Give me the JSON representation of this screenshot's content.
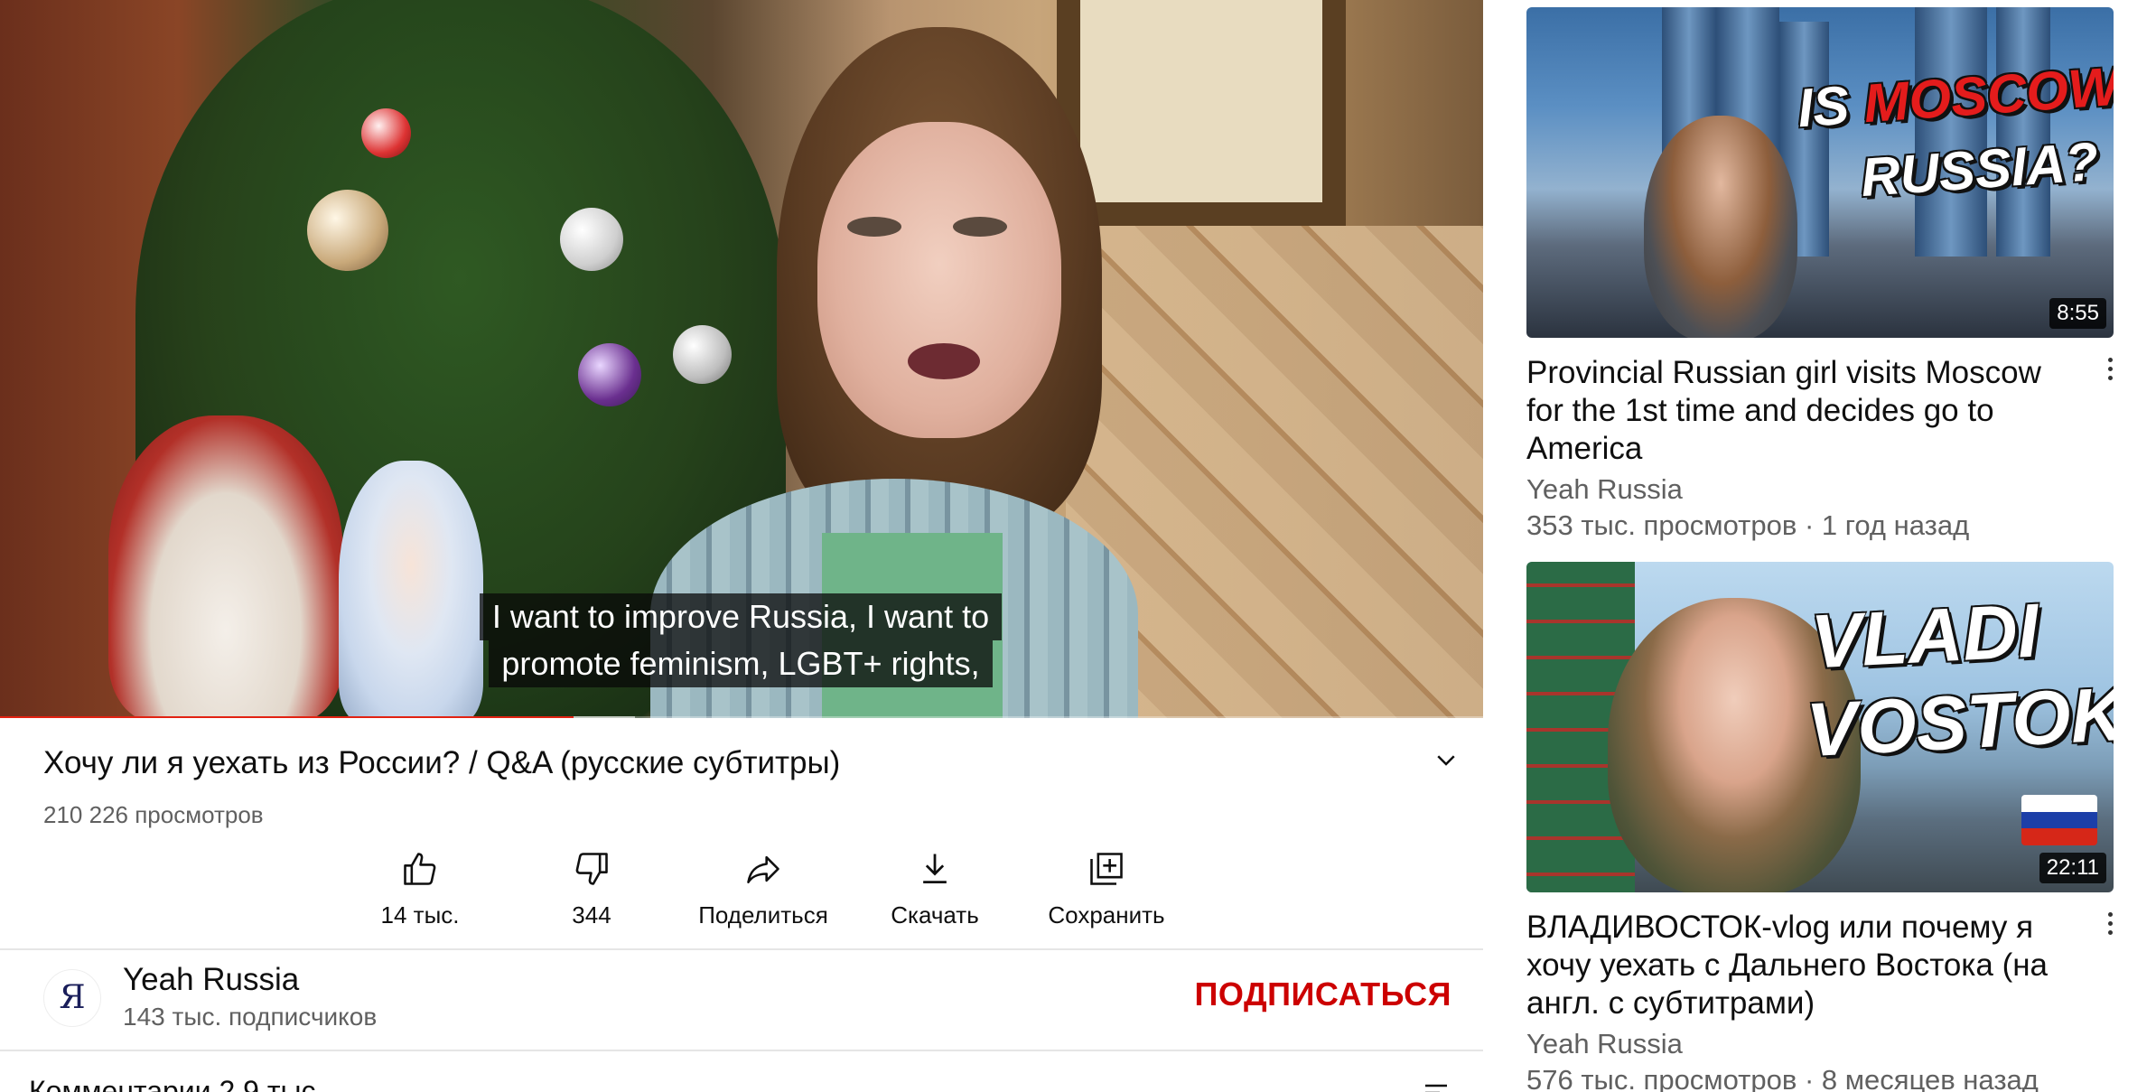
{
  "player": {
    "caption_line1": "I want to improve Russia, I want to",
    "caption_line2": "promote feminism, LGBT+ rights,",
    "progress": 0.387,
    "buffered": 0.428
  },
  "video": {
    "title": "Хочу ли я уехать из России? / Q&A (русские субтитры)",
    "views": "210 226 просмотров"
  },
  "actions": [
    {
      "icon": "like-icon",
      "label": "14 тыс."
    },
    {
      "icon": "dislike-icon",
      "label": "344"
    },
    {
      "icon": "share-icon",
      "label": "Поделиться"
    },
    {
      "icon": "download-icon",
      "label": "Скачать"
    },
    {
      "icon": "save-playlist-icon",
      "label": "Сохранить"
    }
  ],
  "channel": {
    "avatar_letter": "Я",
    "name": "Yeah Russia",
    "subscribers": "143 тыс. подписчиков",
    "subscribe_label": "ПОДПИСАТЬСЯ"
  },
  "comments": {
    "header": "Комментарии 2,9 тыс."
  },
  "recommendations": [
    {
      "thumb_text_line1_a": "IS ",
      "thumb_text_line1_b": "MOSCOW",
      "thumb_text_line2": "RUSSIA?",
      "duration": "8:55",
      "title": "Provincial Russian girl visits Moscow for the 1st time and decides go to America",
      "channel": "Yeah Russia",
      "meta": "353 тыс. просмотров · 1 год назад"
    },
    {
      "thumb_text_line1": "VLADI",
      "thumb_text_line2": "VOSTOK",
      "duration": "22:11",
      "title": "ВЛАДИВОСТОК-vlog или почему я хочу уехать с Дальнего Востока (на англ. с субтитрами)",
      "channel": "Yeah Russia",
      "meta": "576 тыс. просмотров · 8 месяцев назад"
    }
  ],
  "colors": {
    "accent_red": "#cc0000",
    "progress_red": "#e22212",
    "secondary_text": "#606060"
  }
}
